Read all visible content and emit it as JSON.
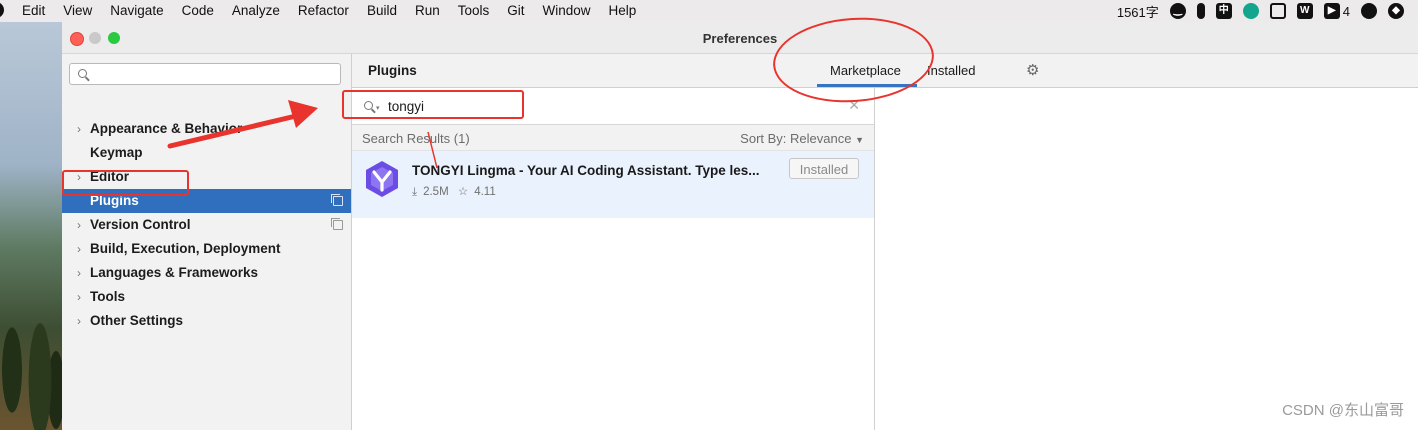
{
  "menubar": {
    "items": [
      "Edit",
      "View",
      "Navigate",
      "Code",
      "Analyze",
      "Refactor",
      "Build",
      "Run",
      "Tools",
      "Git",
      "Window",
      "Help"
    ],
    "word_count": "1561字",
    "status_badge": "4",
    "status_icons": [
      "emoji-icon",
      "mic-icon",
      "input-method-icon",
      "app-icon",
      "window-icon",
      "wps-icon",
      "bear-icon",
      "wechat-icon",
      "shield-icon"
    ],
    "input_method": "中"
  },
  "window": {
    "title": "Preferences"
  },
  "sidebar": {
    "search_placeholder": "",
    "items": [
      {
        "label": "Appearance & Behavior",
        "expandable": true
      },
      {
        "label": "Keymap",
        "expandable": false
      },
      {
        "label": "Editor",
        "expandable": true
      },
      {
        "label": "Plugins",
        "expandable": false,
        "selected": true
      },
      {
        "label": "Version Control",
        "expandable": true
      },
      {
        "label": "Build, Execution, Deployment",
        "expandable": true
      },
      {
        "label": "Languages & Frameworks",
        "expandable": true
      },
      {
        "label": "Tools",
        "expandable": true
      },
      {
        "label": "Other Settings",
        "expandable": true
      }
    ]
  },
  "plugins": {
    "title": "Plugins",
    "tabs": [
      "Marketplace",
      "Installed"
    ],
    "active_tab": "Marketplace",
    "search": {
      "value": "tongyi"
    },
    "results_label": "Search Results (1)",
    "sort_label": "Sort By: Relevance",
    "results": [
      {
        "name": "TONGYI Lingma - Your AI Coding Assistant. Type les...",
        "downloads": "2.5M",
        "rating": "4.11",
        "action": "Installed"
      }
    ]
  },
  "watermark": "CSDN @东山富哥",
  "colors": {
    "selection": "#2f6fbd",
    "annotation": "#e8342c",
    "tab_underline": "#3574c3"
  }
}
